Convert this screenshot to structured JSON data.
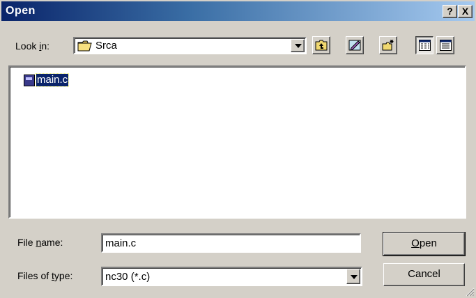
{
  "dialog": {
    "title": "Open",
    "help_glyph": "?",
    "close_glyph": "X"
  },
  "look_in": {
    "label_pre": "Look ",
    "label_u": "i",
    "label_post": "n:",
    "value": "Srca",
    "icon": "folder-icon"
  },
  "toolbar": {
    "buttons": [
      "up-one-level-icon",
      "desktop-icon",
      "new-folder-icon",
      "list-view-icon",
      "details-view-icon"
    ]
  },
  "files": [
    {
      "name": "main.c",
      "icon": "c-source-file-icon",
      "selected": true
    }
  ],
  "file_name": {
    "label_pre": "File ",
    "label_u": "n",
    "label_post": "ame:",
    "value": "main.c"
  },
  "file_type": {
    "label_pre": "Files of ",
    "label_u": "t",
    "label_post": "ype:",
    "value": "nc30 (*.c)"
  },
  "buttons": {
    "open_u": "O",
    "open_rest": "pen",
    "cancel": "Cancel"
  },
  "colors": {
    "title_start": "#0a246a",
    "title_end": "#a6caf0",
    "face": "#d4d0c8",
    "selection": "#0a246a"
  }
}
